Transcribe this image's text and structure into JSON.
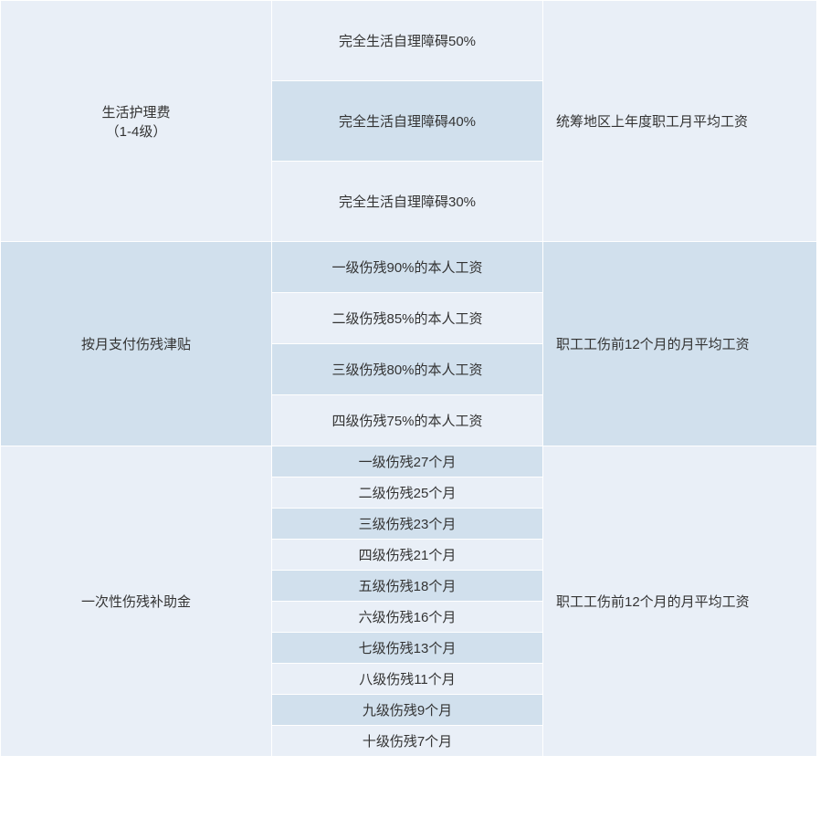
{
  "sections": [
    {
      "title_line1": "生活护理费",
      "title_line2": "（1-4级）",
      "basis": "统筹地区上年度职工月平均工资",
      "items": [
        "完全生活自理障碍50%",
        "完全生活自理障碍40%",
        "完全生活自理障碍30%"
      ]
    },
    {
      "title": "按月支付伤残津贴",
      "basis": "职工工伤前12个月的月平均工资",
      "items": [
        "一级伤残90%的本人工资",
        "二级伤残85%的本人工资",
        "三级伤残80%的本人工资",
        "四级伤残75%的本人工资"
      ]
    },
    {
      "title": "一次性伤残补助金",
      "basis": "职工工伤前12个月的月平均工资",
      "items": [
        "一级伤残27个月",
        "二级伤残25个月",
        "三级伤残23个月",
        "四级伤残21个月",
        "五级伤残18个月",
        "六级伤残16个月",
        "七级伤残13个月",
        "八级伤残11个月",
        "九级伤残9个月",
        "十级伤残7个月"
      ]
    }
  ]
}
